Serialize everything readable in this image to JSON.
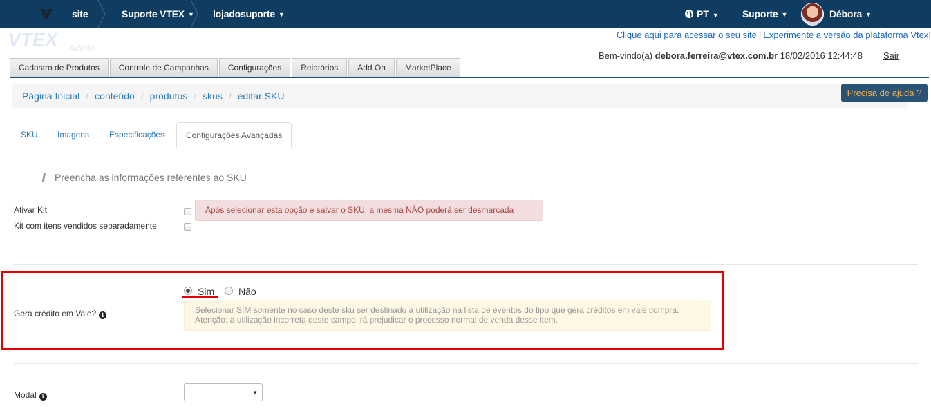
{
  "topbar": {
    "site": "site",
    "account": "Suporte VTEX",
    "store": "lojadosuporte",
    "language": "PT",
    "support": "Suporte",
    "user": "Débora",
    "caret": "▼"
  },
  "header": {
    "logo_text": "VTEX",
    "logo_sub": "Admin",
    "link_site": "Clique aqui para acessar o seu site",
    "link_separator": "|",
    "link_platform": "Experimente a versão da plataforma Vtex!",
    "welcome_prefix": "Bem-vindo(a)",
    "email": "debora.ferreira@vtex.com.br",
    "datetime": "18/02/2016 12:44:48",
    "logout": "Sair"
  },
  "menu": {
    "tabs": [
      "Cadastro de Produtos",
      "Controle de Campanhas",
      "Configurações",
      "Relatórios",
      "Add On",
      "MarketPlace"
    ]
  },
  "breadcrumb": {
    "items": [
      "Página Inicial",
      "conteúdo",
      "produtos",
      "skus",
      "editar SKU"
    ],
    "divider": "/"
  },
  "help_button": "Precisa de ajuda ?",
  "subtabs": {
    "items": [
      "SKU",
      "Imagens",
      "Especificações",
      "Configurações Avançadas"
    ],
    "active": "Configurações Avançadas"
  },
  "form": {
    "legend": "Preencha as informações referentes ao SKU",
    "kit_label": "Ativar Kit",
    "kit_separate_label": "Kit com itens vendidos separadamente",
    "kit_warning": "Após selecionar esta opção e salvar o SKU, a mesma NÃO poderá ser desmarcada",
    "credit_label": "Gera crédito em Vale?",
    "credit_yes": "Sim",
    "credit_no": "Não",
    "credit_selected": "Sim",
    "credit_warning_line1": "Selecionar SIM somente no caso deste sku ser destinado a utilização na lista de eventos do tipo que gera créditos em vale compra.",
    "credit_warning_line2": "Atenção: a utilização incorreta deste campo irá prejudicar o processo normal de venda desse item.",
    "modal_label": "Modal",
    "modal_value": "",
    "info_glyph": "i",
    "select_arrow": "▼"
  },
  "colors": {
    "topbar": "#0f3d61",
    "highlight": "#e30000",
    "help_button_bg": "#285374",
    "help_button_text": "#f0ad4e",
    "link": "#2a7bbf"
  }
}
